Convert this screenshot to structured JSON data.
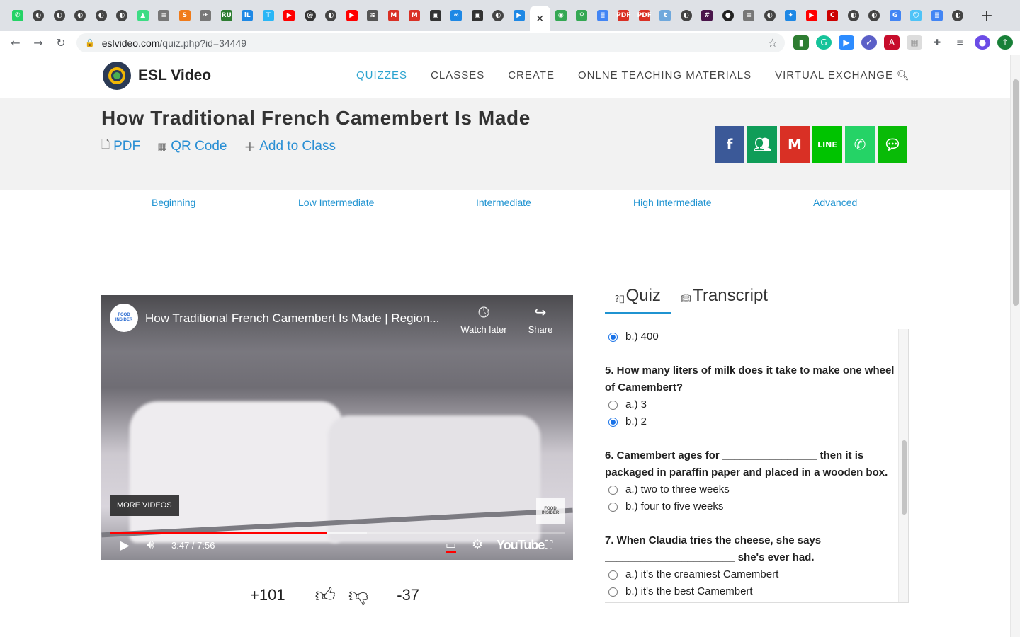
{
  "browser": {
    "url_host": "eslvideo.com",
    "url_path": "/quiz.php?id=34449",
    "tabs": [
      {
        "icon": "whatsapp",
        "color": "#25d366",
        "glyph": "✆"
      },
      {
        "icon": "globe",
        "color": "#444444",
        "glyph": "◐"
      },
      {
        "icon": "globe",
        "color": "#444444",
        "glyph": "◐"
      },
      {
        "icon": "globe",
        "color": "#444444",
        "glyph": "◐"
      },
      {
        "icon": "globe",
        "color": "#444444",
        "glyph": "◐"
      },
      {
        "icon": "globe",
        "color": "#444444",
        "glyph": "◐"
      },
      {
        "icon": "android",
        "color": "#3ddc84",
        "glyph": "▲"
      },
      {
        "icon": "database",
        "color": "#777777",
        "glyph": "≡"
      },
      {
        "icon": "s-app",
        "color": "#f07b1a",
        "glyph": "S"
      },
      {
        "icon": "bird",
        "color": "#777777",
        "glyph": "✈"
      },
      {
        "icon": "ru",
        "color": "#2e7d32",
        "glyph": "RU"
      },
      {
        "icon": "il",
        "color": "#1e88e5",
        "glyph": "iL"
      },
      {
        "icon": "t-app",
        "color": "#29b6f6",
        "glyph": "T"
      },
      {
        "icon": "youtube",
        "color": "#ff0000",
        "glyph": "▶"
      },
      {
        "icon": "swirl",
        "color": "#333333",
        "glyph": "@"
      },
      {
        "icon": "globe",
        "color": "#444444",
        "glyph": "◐"
      },
      {
        "icon": "youtube",
        "color": "#ff0000",
        "glyph": "▶"
      },
      {
        "icon": "wave",
        "color": "#555555",
        "glyph": "≋"
      },
      {
        "icon": "gmail",
        "color": "#d93025",
        "glyph": "M"
      },
      {
        "icon": "gmail",
        "color": "#d93025",
        "glyph": "M"
      },
      {
        "icon": "contact",
        "color": "#333333",
        "glyph": "▣"
      },
      {
        "icon": "link",
        "color": "#1e88e5",
        "glyph": "∞"
      },
      {
        "icon": "contact",
        "color": "#333333",
        "glyph": "▣"
      },
      {
        "icon": "globe",
        "color": "#444444",
        "glyph": "◐"
      },
      {
        "icon": "tv",
        "color": "#1e88e5",
        "glyph": "▶"
      },
      {
        "icon": "close",
        "color": "#333333",
        "glyph": "✕"
      },
      {
        "icon": "green-app",
        "color": "#34a853",
        "glyph": "◉"
      },
      {
        "icon": "maps",
        "color": "#34a853",
        "glyph": "⚲"
      },
      {
        "icon": "docs",
        "color": "#4285f4",
        "glyph": "≣"
      },
      {
        "icon": "pdf",
        "color": "#d93025",
        "glyph": "PDF"
      },
      {
        "icon": "pdf",
        "color": "#d93025",
        "glyph": "PDF"
      },
      {
        "icon": "t-blue",
        "color": "#6fa8dc",
        "glyph": "t"
      },
      {
        "icon": "globe",
        "color": "#444444",
        "glyph": "◐"
      },
      {
        "icon": "slack",
        "color": "#4a154b",
        "glyph": "#"
      },
      {
        "icon": "github",
        "color": "#222222",
        "glyph": "●"
      },
      {
        "icon": "database",
        "color": "#777777",
        "glyph": "≡"
      },
      {
        "icon": "globe",
        "color": "#444444",
        "glyph": "◐"
      },
      {
        "icon": "bluebird",
        "color": "#1e88e5",
        "glyph": "✦"
      },
      {
        "icon": "youtube",
        "color": "#ff0000",
        "glyph": "▶"
      },
      {
        "icon": "canon",
        "color": "#cc0000",
        "glyph": "C"
      },
      {
        "icon": "globe",
        "color": "#444444",
        "glyph": "◐"
      },
      {
        "icon": "globe",
        "color": "#444444",
        "glyph": "◐"
      },
      {
        "icon": "google",
        "color": "#4285f4",
        "glyph": "G"
      },
      {
        "icon": "face",
        "color": "#4fc3f7",
        "glyph": "☺"
      },
      {
        "icon": "docs",
        "color": "#4285f4",
        "glyph": "≣"
      },
      {
        "icon": "globe",
        "color": "#444444",
        "glyph": "◐"
      }
    ],
    "new_tab": "+"
  },
  "site": {
    "brand": "ESL Video",
    "nav": [
      "QUIZZES",
      "CLASSES",
      "CREATE",
      "ONLNE TEACHING MATERIALS",
      "VIRTUAL EXCHANGE"
    ],
    "active_nav": "QUIZZES"
  },
  "hero": {
    "title": "How Traditional French Camembert Is Made",
    "pdf": "PDF",
    "qr": "QR Code",
    "add": "Add to Class",
    "share_colors": {
      "facebook": "#3b5998",
      "classroom": "#0f9d58",
      "gmail": "#d93025",
      "line": "#00c300",
      "whatsapp": "#25d366",
      "wechat": "#09bb07"
    }
  },
  "levels": [
    "Beginning",
    "Low Intermediate",
    "Intermediate",
    "High Intermediate",
    "Advanced"
  ],
  "video": {
    "channel": "FOOD INSIDER",
    "title": "How Traditional French Camembert Is Made | Region...",
    "watermark": "INSIDER",
    "watch_later": "Watch later",
    "share": "Share",
    "more": "MORE VIDEOS",
    "time": "3:47 / 7:56",
    "played_fraction": 0.477,
    "buffered_fraction": 0.565,
    "youtube": "YouTube"
  },
  "votes": {
    "up": "+101",
    "down": "-37"
  },
  "quiz": {
    "tabs": [
      "Quiz",
      "Transcript"
    ],
    "prev_selected": "b.) 400",
    "questions": [
      {
        "q": "5. How many liters of milk does it take to make one wheel of Camembert?",
        "a": "a.) 3",
        "b": "b.) 2",
        "selected": "b"
      },
      {
        "q": "6. Camembert ages for ________________ then it is packaged in paraffin paper and placed in a wooden box.",
        "a": "a.) two to three weeks",
        "b": "b.) four to five weeks",
        "selected": ""
      },
      {
        "q": "7. When Claudia tries the cheese, she says ______________________ she's ever had.",
        "a": "a.) it's the creamiest Camembert",
        "b": "b.) it's the best Camembert",
        "selected": ""
      }
    ]
  }
}
